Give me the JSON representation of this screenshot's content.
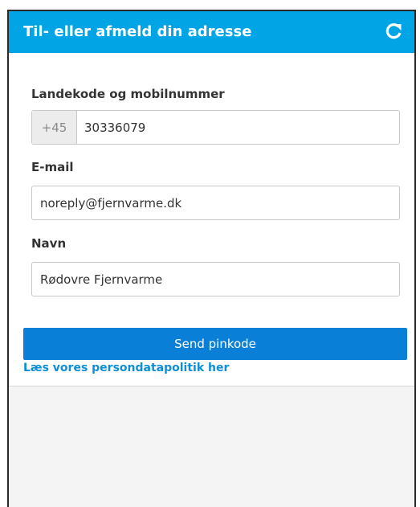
{
  "header": {
    "title": "Til- eller afmeld din adresse",
    "refresh_icon": "refresh-icon"
  },
  "form": {
    "phone": {
      "label": "Landekode og mobilnummer",
      "country_code": "+45",
      "value": "30336079"
    },
    "email": {
      "label": "E-mail",
      "value": "noreply@fjernvarme.dk"
    },
    "name": {
      "label": "Navn",
      "value": "Rødovre Fjernvarme"
    },
    "submit_label": "Send pinkode",
    "privacy_link": "Læs vores persondatapolitik her"
  },
  "colors": {
    "header_bg": "#01a4e4",
    "button_bg": "#0a7fd8",
    "link": "#0a8fd8"
  }
}
